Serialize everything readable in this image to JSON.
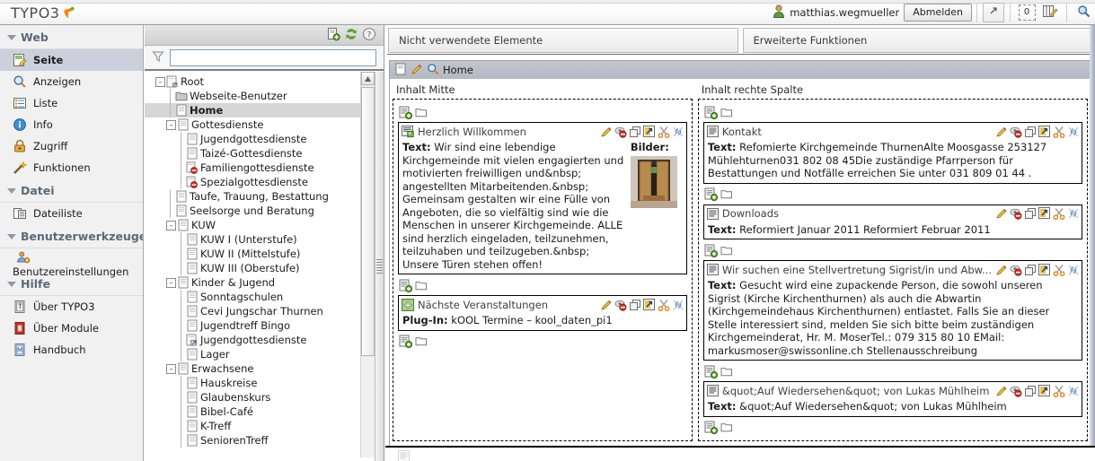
{
  "app": {
    "logo_text": "TYPO3",
    "logo_icon": "typo3-leaf-icon"
  },
  "topbar": {
    "user_icon": "user-icon",
    "username": "matthias.wegmueller",
    "logout_label": "Abmelden",
    "shortcut_icon": "open-in-new-window-icon",
    "clipboard_count": "0",
    "clipboard_icon": "clipboard-edit-icon",
    "search_icon": "search-icon"
  },
  "modmenu": {
    "groups": [
      {
        "label": "Web",
        "toggle_icon": "chevron-down-icon",
        "items": [
          {
            "label": "Seite",
            "icon": "page-edit-icon",
            "active": true
          },
          {
            "label": "Anzeigen",
            "icon": "view-page-icon",
            "active": false
          },
          {
            "label": "Liste",
            "icon": "list-icon",
            "active": false
          },
          {
            "label": "Info",
            "icon": "info-icon",
            "active": false
          },
          {
            "label": "Zugriff",
            "icon": "lock-icon",
            "active": false
          },
          {
            "label": "Funktionen",
            "icon": "magic-wand-icon",
            "active": false
          }
        ]
      },
      {
        "label": "Datei",
        "toggle_icon": "chevron-down-icon",
        "items": [
          {
            "label": "Dateiliste",
            "icon": "file-list-icon",
            "active": false
          }
        ]
      },
      {
        "label": "Benutzerwerkzeuge",
        "toggle_icon": "chevron-down-icon",
        "items": [
          {
            "label": "Benutzereinstellungen",
            "icon": "user-settings-icon",
            "active": false,
            "wide": true
          }
        ]
      },
      {
        "label": "Hilfe",
        "toggle_icon": "chevron-down-icon",
        "items": [
          {
            "label": "Über TYPO3",
            "icon": "about-typo3-icon",
            "active": false
          },
          {
            "label": "Über Module",
            "icon": "about-modules-icon",
            "active": false
          },
          {
            "label": "Handbuch",
            "icon": "manual-icon",
            "active": false
          }
        ]
      }
    ]
  },
  "treepanel": {
    "toolbar": {
      "new_page_icon": "new-page-icon",
      "refresh_icon": "refresh-icon",
      "help_icon": "help-icon"
    },
    "filter": {
      "icon": "filter-icon",
      "value": "",
      "placeholder": ""
    },
    "nodes": [
      {
        "label": "Root",
        "depth": 0,
        "toggle": "minus",
        "icon": "root-page-icon",
        "selected": false
      },
      {
        "label": "Webseite-Benutzer",
        "depth": 1,
        "toggle": "none",
        "icon": "folder-icon",
        "selected": false
      },
      {
        "label": "Home",
        "depth": 1,
        "toggle": "none",
        "icon": "page-icon",
        "selected": true
      },
      {
        "label": "Gottesdienste",
        "depth": 1,
        "toggle": "minus",
        "icon": "page-icon",
        "selected": false
      },
      {
        "label": "Jugendgottesdienste",
        "depth": 2,
        "toggle": "none",
        "icon": "page-icon",
        "selected": false
      },
      {
        "label": "Taizé-Gottesdienste",
        "depth": 2,
        "toggle": "none",
        "icon": "page-icon",
        "selected": false
      },
      {
        "label": "Familiengottesdienste",
        "depth": 2,
        "toggle": "none",
        "icon": "page-hidden-icon",
        "selected": false
      },
      {
        "label": "Spezialgottesdienste",
        "depth": 2,
        "toggle": "none",
        "icon": "page-hidden-icon",
        "selected": false
      },
      {
        "label": "Taufe, Trauung, Bestattung",
        "depth": 1,
        "toggle": "none",
        "icon": "page-icon",
        "selected": false
      },
      {
        "label": "Seelsorge und Beratung",
        "depth": 1,
        "toggle": "none",
        "icon": "page-icon",
        "selected": false
      },
      {
        "label": "KUW",
        "depth": 1,
        "toggle": "minus",
        "icon": "page-icon",
        "selected": false
      },
      {
        "label": "KUW I (Unterstufe)",
        "depth": 2,
        "toggle": "none",
        "icon": "page-icon",
        "selected": false
      },
      {
        "label": "KUW II (Mittelstufe)",
        "depth": 2,
        "toggle": "none",
        "icon": "page-icon",
        "selected": false
      },
      {
        "label": "KUW III (Oberstufe)",
        "depth": 2,
        "toggle": "none",
        "icon": "page-icon",
        "selected": false
      },
      {
        "label": "Kinder & Jugend",
        "depth": 1,
        "toggle": "minus",
        "icon": "page-icon",
        "selected": false
      },
      {
        "label": "Sonntagschulen",
        "depth": 2,
        "toggle": "none",
        "icon": "page-icon",
        "selected": false
      },
      {
        "label": "Cevi Jungschar Thurnen",
        "depth": 2,
        "toggle": "none",
        "icon": "page-icon",
        "selected": false
      },
      {
        "label": "Jugendtreff Bingo",
        "depth": 2,
        "toggle": "none",
        "icon": "page-icon",
        "selected": false
      },
      {
        "label": "Jugendgottesdienste",
        "depth": 2,
        "toggle": "none",
        "icon": "page-shortcut-icon",
        "selected": false
      },
      {
        "label": "Lager",
        "depth": 2,
        "toggle": "none",
        "icon": "page-icon",
        "selected": false
      },
      {
        "label": "Erwachsene",
        "depth": 1,
        "toggle": "minus",
        "icon": "page-icon",
        "selected": false
      },
      {
        "label": "Hauskreise",
        "depth": 2,
        "toggle": "none",
        "icon": "page-icon",
        "selected": false
      },
      {
        "label": "Glaubenskurs",
        "depth": 2,
        "toggle": "none",
        "icon": "page-icon",
        "selected": false
      },
      {
        "label": "Bibel-Café",
        "depth": 2,
        "toggle": "none",
        "icon": "page-icon",
        "selected": false
      },
      {
        "label": "K-Treff",
        "depth": 2,
        "toggle": "none",
        "icon": "page-icon",
        "selected": false
      },
      {
        "label": "SeniorenTreff",
        "depth": 2,
        "toggle": "none",
        "icon": "page-icon",
        "selected": false
      }
    ],
    "scrollbar": {
      "up_arrow_icon": "scroll-up-icon",
      "resize_handle_icon": "resize-grip-icon",
      "collapse_icon": "collapse-left-icon"
    }
  },
  "content": {
    "tabs": [
      {
        "label": "Nicht verwendete Elemente"
      },
      {
        "label": "Erweiterte Funktionen"
      }
    ],
    "pagehead": {
      "page_icon": "page-icon",
      "edit_icon": "pencil-icon",
      "view_icon": "search-icon",
      "title": "Home"
    },
    "action_icons": [
      "pencil-icon",
      "hide-icon",
      "copy-icon",
      "move-icon",
      "cut-icon",
      "unlink-icon"
    ],
    "new_content_icon": "new-content-element-icon",
    "paste_icon": "folder-paste-icon",
    "columns": [
      {
        "title": "Inhalt Mitte",
        "elements": [
          {
            "icon": "text-with-image-icon",
            "title": "Herzlich Willkommen",
            "label": "Text:",
            "text": "Wir sind eine lebendige Kirchgemeinde mit vielen engagierten und motivierten freiwilligen und&nbsp; angestellten Mitarbeitenden.&nbsp; Gemeinsam gestalten wir eine Fülle von Angeboten, die so vielfältig sind wie die Menschen in unserer Kirchgemeinde. ALLE sind herzlich eingeladen, teilzunehmen, teilzuhaben und teilzugeben.&nbsp; Unsere Türen stehen offen!",
            "image_label": "Bilder:",
            "image_alt": "church-doors-thumbnail"
          },
          {
            "icon": "plugin-icon",
            "title": "Nächste Veranstaltungen",
            "label": "Plug-In:",
            "text": "kOOL Termine – kool_daten_pi1"
          }
        ]
      },
      {
        "title": "Inhalt rechte Spalte",
        "elements": [
          {
            "icon": "text-icon",
            "title": "Kontakt",
            "label": "Text:",
            "text": "Refomierte Kirchgemeinde ThurnenAlte Moosgasse 253127 Mühlehturnen031 802 08 45Die zuständige Pfarrperson für Bestattungen und Notfälle erreichen Sie unter 031 809 01 44 ."
          },
          {
            "icon": "text-icon",
            "title": "Downloads",
            "label": "Text:",
            "text": "Reformiert Januar 2011 Reformiert Februar 2011"
          },
          {
            "icon": "text-icon",
            "title": "Wir suchen eine Stellvertretung Sigrist/in und Abw...",
            "label": "Text:",
            "text": "Gesucht wird eine zupackende Person, die sowohl unseren Sigrist (Kirche Kirchenthurnen) als auch die Abwartin (Kirchgemeindehaus Kirchenthurnen) entlastet. Falls Sie an dieser Stelle interessiert sind, melden Sie sich bitte beim zuständigen Kirchgemeinderat, Hr. M. MoserTel.: 079 315 80 10 EMail: markusmoser@swissonline.ch Stellenausschreibung"
          },
          {
            "icon": "text-icon",
            "title": "&quot;Auf Wiedersehen&quot; von Lukas Mühlheim",
            "label": "Text:",
            "text": "&quot;Auf Wiedersehen&quot; von Lukas Mühlheim"
          }
        ]
      }
    ]
  }
}
